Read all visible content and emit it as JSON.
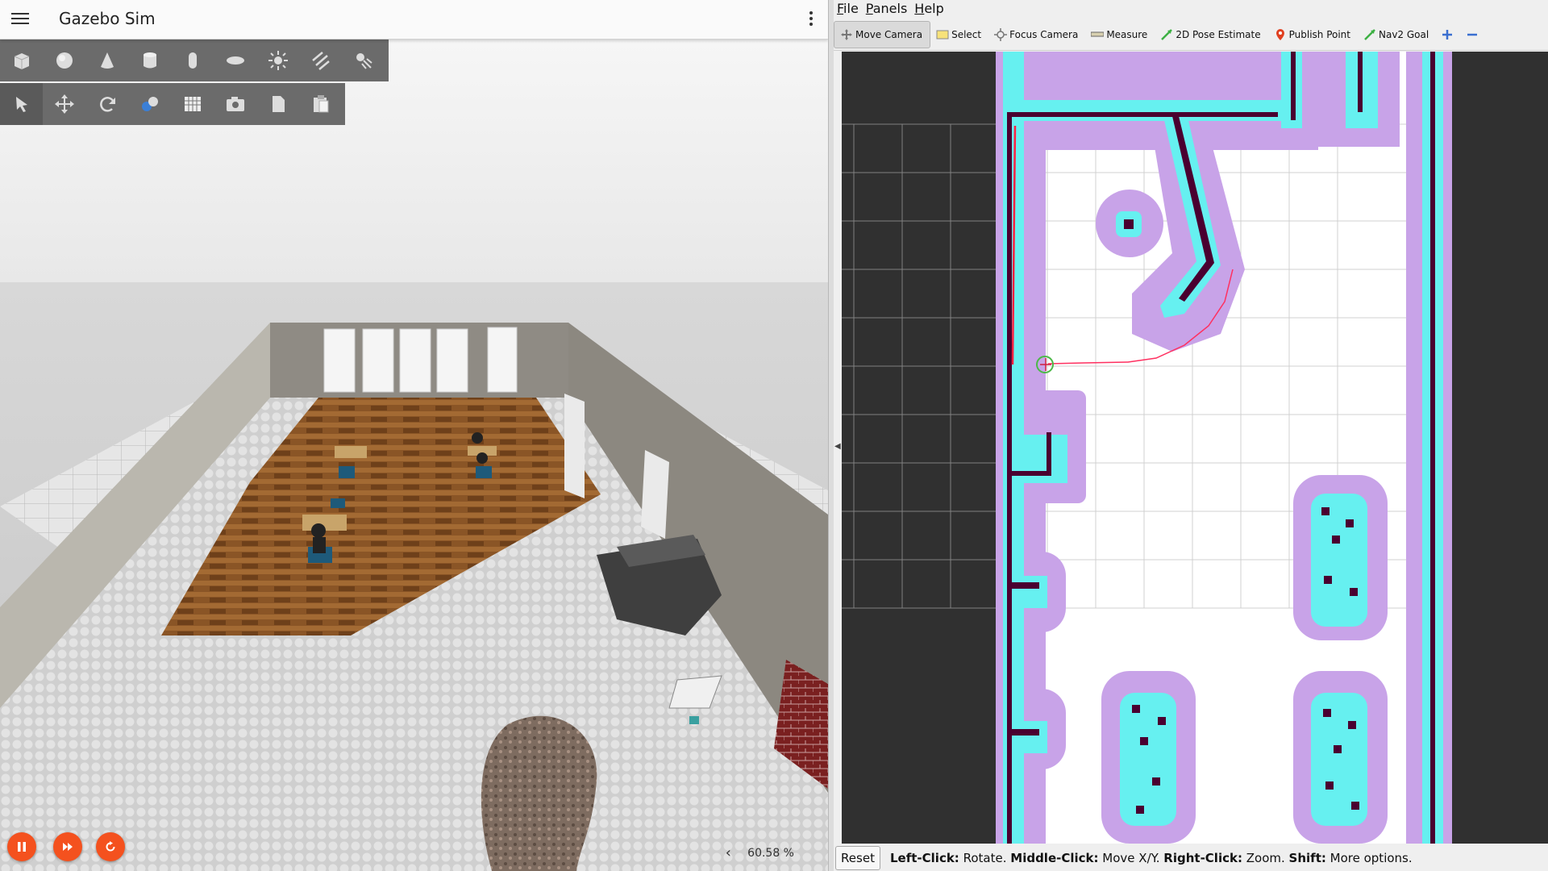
{
  "gazebo": {
    "title": "Gazebo Sim",
    "shape_tools": [
      "box-icon",
      "sphere-icon",
      "cone-icon",
      "cylinder-icon",
      "capsule-icon",
      "ellipsoid-icon",
      "sun-icon",
      "directional-light-icon",
      "spot-light-icon"
    ],
    "transform_tools": [
      "select-cursor-icon",
      "translate-icon",
      "rotate-icon",
      "grid-snap-icon",
      "grid-icon",
      "camera-icon",
      "copy-icon",
      "paste-icon"
    ],
    "rtf": "60.58 %",
    "play_controls": [
      "pause-icon",
      "step-icon",
      "reset-icon"
    ],
    "accent_color": "#f4511e"
  },
  "rviz": {
    "menu": [
      {
        "label": "File",
        "hint": "F"
      },
      {
        "label": "Panels",
        "hint": "P"
      },
      {
        "label": "Help",
        "hint": "H"
      }
    ],
    "tools": [
      {
        "label": "Move Camera",
        "icon": "move-camera-icon",
        "active": true
      },
      {
        "label": "Select",
        "icon": "select-icon"
      },
      {
        "label": "Focus Camera",
        "icon": "focus-camera-icon"
      },
      {
        "label": "Measure",
        "icon": "measure-icon"
      },
      {
        "label": "2D Pose Estimate",
        "icon": "pose-estimate-icon"
      },
      {
        "label": "Publish Point",
        "icon": "publish-point-icon"
      },
      {
        "label": "Nav2 Goal",
        "icon": "nav-goal-icon"
      }
    ],
    "status": {
      "reset": "Reset",
      "left_key": "Left-Click:",
      "left_action": "Rotate.",
      "middle_key": "Middle-Click:",
      "middle_action": "Move X/Y.",
      "right_key": "Right-Click:",
      "right_action": "Zoom.",
      "shift_key": "Shift:",
      "shift_action": "More options."
    },
    "costmap_colors": {
      "lethal": "#4a0030",
      "inscribed": "#66f0f0",
      "inflation": "#c79be6",
      "free": "#ffffff",
      "unknown": "#303030",
      "path": "#ff2040"
    }
  }
}
